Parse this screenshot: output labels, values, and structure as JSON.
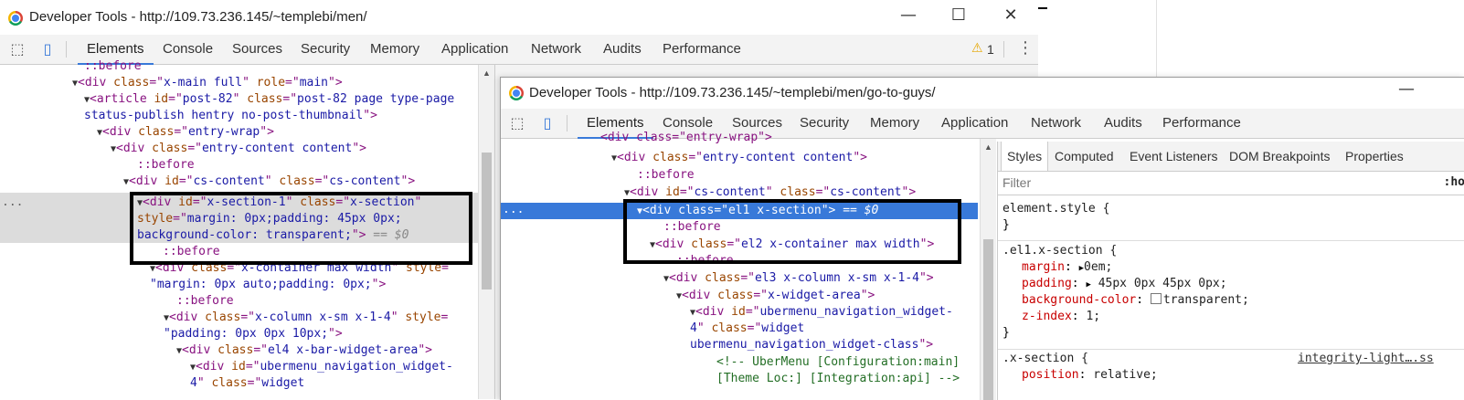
{
  "window1": {
    "title": "Developer Tools - http://109.73.236.145/~templebi/men/",
    "controls": {
      "minimize": "—",
      "maximize": "☐",
      "close": "✕"
    },
    "tabs": [
      "Elements",
      "Console",
      "Sources",
      "Security",
      "Memory",
      "Application",
      "Network",
      "Audits",
      "Performance"
    ],
    "warning_count": "1",
    "dom": {
      "l1": "::before",
      "l2a": "<div ",
      "l2b": "class",
      "l2c": "=\"",
      "l2d": "x-main full",
      "l2e": "\" ",
      "l2f": "role",
      "l2g": "=\"",
      "l2h": "main",
      "l2i": "\">",
      "l3a": "<article ",
      "l3b": "id",
      "l3c": "=\"",
      "l3d": "post-82",
      "l3e": "\" ",
      "l3f": "class",
      "l3g": "=\"",
      "l3h": "post-82 page type-page",
      "l4": "status-publish hentry no-post-thumbnail",
      "l4end": "\">",
      "l5a": "<div ",
      "l5b": "class",
      "l5c": "=\"",
      "l5d": "entry-wrap",
      "l5e": "\">",
      "l6a": "<div ",
      "l6b": "class",
      "l6c": "=\"",
      "l6d": "entry-content content",
      "l6e": "\">",
      "l7": "::before",
      "l8a": "<div ",
      "l8b": "id",
      "l8c": "=\"",
      "l8d": "cs-content",
      "l8e": "\" ",
      "l8f": "class",
      "l8g": "=\"",
      "l8h": "cs-content",
      "l8i": "\">",
      "l9a": "<div ",
      "l9b": "id",
      "l9c": "=\"",
      "l9d": "x-section-1",
      "l9e": "\" ",
      "l9f": "class",
      "l9g": "=\"",
      "l9h": "x-section",
      "l9i": "\"",
      "l10a": "style",
      "l10b": "=\"",
      "l10c": "margin: 0px;padding: 45px 0px;",
      "l11a": "background-color: transparent;",
      "l11b": "\">",
      "l11c": " == $0",
      "l12": "::before",
      "l13a": "<div ",
      "l13b": "class",
      "l13c": "=\"",
      "l13d": "x-container max width",
      "l13e": "\" ",
      "l13f": "style",
      "l13g": "=",
      "l14a": "\"",
      "l14b": "margin: 0px auto;padding: 0px;",
      "l14c": "\">",
      "l15": "::before",
      "l16a": "<div ",
      "l16b": "class",
      "l16c": "=\"",
      "l16d": "x-column x-sm x-1-4",
      "l16e": "\" ",
      "l16f": "style",
      "l16g": "=",
      "l17a": "\"",
      "l17b": "padding: 0px 0px 10px;",
      "l17c": "\">",
      "l18a": "<div ",
      "l18b": "class",
      "l18c": "=\"",
      "l18d": "el4 x-bar-widget-area",
      "l18e": "\">",
      "l19a": "<div ",
      "l19b": "id",
      "l19c": "=\"",
      "l19d": "ubermenu_navigation_widget-",
      "l20a": "4",
      "l20b": "\" ",
      "l20c": "class",
      "l20d": "=\"",
      "l20e": "widget"
    },
    "dots": "..."
  },
  "window2": {
    "title": "Developer Tools - http://109.73.236.145/~templebi/men/go-to-guys/",
    "controls": {
      "minimize": "—"
    },
    "tabs": [
      "Elements",
      "Console",
      "Sources",
      "Security",
      "Memory",
      "Application",
      "Network",
      "Audits",
      "Performance"
    ],
    "dom": {
      "l0": "<div class=\"entry-wrap\">",
      "l1a": "<div ",
      "l1b": "class",
      "l1c": "=\"",
      "l1d": "entry-content content",
      "l1e": "\">",
      "l2": "::before",
      "l3a": "<div ",
      "l3b": "id",
      "l3c": "=\"",
      "l3d": "cs-content",
      "l3e": "\" ",
      "l3f": "class",
      "l3g": "=\"",
      "l3h": "cs-content",
      "l3i": "\">",
      "l4a": "<div ",
      "l4b": "class",
      "l4c": "=\"",
      "l4d": "el1 x-section",
      "l4e": "\">",
      "l4f": " == $0",
      "l5": "::before",
      "l6a": "<div ",
      "l6b": "class",
      "l6c": "=\"",
      "l6d": "el2 x-container max width",
      "l6e": "\">",
      "l7": "::before",
      "l8a": "<div ",
      "l8b": "class",
      "l8c": "=\"",
      "l8d": "el3 x-column x-sm x-1-4",
      "l8e": "\">",
      "l9a": "<div ",
      "l9b": "class",
      "l9c": "=\"",
      "l9d": "x-widget-area",
      "l9e": "\">",
      "l10a": "<div ",
      "l10b": "id",
      "l10c": "=\"",
      "l10d": "ubermenu_navigation_widget-",
      "l11a": "4",
      "l11b": "\" ",
      "l11c": "class",
      "l11d": "=\"",
      "l11e": "widget",
      "l12a": "ubermenu_navigation_widget-class",
      "l12b": "\">",
      "l13": "<!-- UberMenu [Configuration:main]",
      "l14": "[Theme Loc:] [Integration:api] -->"
    },
    "dots": "...",
    "styles": {
      "tabs": [
        "Styles",
        "Computed",
        "Event Listeners",
        "DOM Breakpoints",
        "Properties"
      ],
      "filter_placeholder": "Filter",
      "filter_right": ":ho",
      "r1_sel": "element.style {",
      "r1_end": "}",
      "r2_sel": ".el1.x-section {",
      "r2_p1": "margin",
      "r2_v1": "0em;",
      "r2_p2": "padding",
      "r2_v2": "45px 0px 45px 0px;",
      "r2_p3": "background-color",
      "r2_v3": "transparent;",
      "r2_p4": "z-index",
      "r2_v4": "1;",
      "r2_end": "}",
      "r3_sel": ".x-section {",
      "r3_link": "integrity-light….ss",
      "r3_p1": "position",
      "r3_v1": "relative;"
    }
  }
}
